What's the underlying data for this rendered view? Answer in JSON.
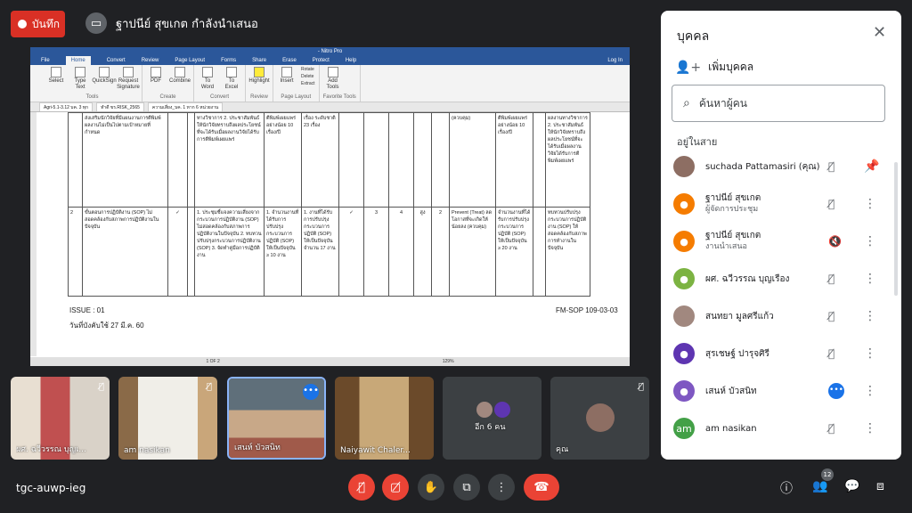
{
  "top": {
    "record_label": "บันทึก",
    "presenter_text": "ฐาปนีย์ สุขเกต กำลังนำเสนอ"
  },
  "screen": {
    "title": "- Nitro Pro",
    "menu": [
      "File",
      "Home",
      "Convert",
      "Review",
      "Page Layout",
      "Forms",
      "Share",
      "Erase",
      "Protect",
      "Help",
      "Log In"
    ],
    "ribbon_groups": [
      {
        "label": "Tools",
        "buttons": [
          "Select",
          "Type Text",
          "QuickSign",
          "Request Signature"
        ]
      },
      {
        "label": "Create",
        "buttons": [
          "PDF",
          "Combine"
        ]
      },
      {
        "label": "Convert",
        "buttons": [
          "To Word",
          "To Excel"
        ]
      },
      {
        "label": "Review",
        "buttons": [
          "Highlight"
        ]
      },
      {
        "label": "Page Layout",
        "buttons": [
          "Insert",
          "Rotate",
          "Delete",
          "Extract"
        ]
      },
      {
        "label": "Favorite Tools",
        "buttons": [
          "Add Tools"
        ]
      }
    ],
    "doc_tabs": [
      "Agri-5.1-3.12 บค. 3 ทุก",
      "ทำดี ขร.RISK_2565",
      "ความเสี่ยง_บค. 1 หาก 6 หน่วยงาน"
    ],
    "table_row1": [
      "",
      "ส่งเสริมนักวิจัยที่มีแผนงานการตีพิมพ์ผลงานไม่เป็นไปตามเป้าหมายที่กำหนด",
      "",
      "",
      "ทางวิชาการ 2. ประชาสัมพันธ์ให้นักวิจัยทราบถึงผลประโยชน์ที่จะได้รับเมื่อผลงานวิจัยได้รับการตีพิมพ์เผยแพร่",
      "ตีพิมพ์เผยแพร่อย่างน้อย 10 เรื่อง/ปี",
      "เรื่อง ระดับชาติ 23 เรื่อง",
      "",
      "",
      "",
      "",
      "",
      "(ควบคุม)",
      "ตีพิมพ์เผยแพร่อย่างน้อย 10 เรื่อง/ปี",
      "",
      "ผลงานทางวิชาการ 2. ประชาสัมพันธ์ให้นักวิจัยทราบถึงผลประโยชน์ที่จะได้รับเมื่อผลงานวิจัยได้รับการตีพิมพ์เผยแพร่"
    ],
    "table_row2": [
      "2",
      "ขั้นตอนการปฏิบัติงาน (SOP) ไม่สอดคล้องกับสภาพการปฏิบัติงานในปัจจุบัน",
      "✓",
      "",
      "1. ประชุมชี้แจงความเสี่ยงจากกระบวนการปฏิบัติงาน (SOP) ไม่สอดคล้องกับสภาพการปฏิบัติงานในปัจจุบัน 2. ทบทวนปรับปรุงกระบวนการปฏิบัติงาน (SOP) 3. จัดทำคู่มือการปฏิบัติงาน",
      "1. จำนวนงานที่ได้รับการปรับปรุงกระบวนการปฏิบัติ (SOP) ให้เป็นปัจจุบัน ≥ 10 งาน",
      "1. งานที่ได้รับการปรับปรุงกระบวนการปฏิบัติ (SOP) ให้เป็นปัจจุบัน จำนวน 17 งาน",
      "✓",
      "3",
      "4",
      "สูง",
      "2",
      "Prevent (Treat) ลดโอกาสที่จะเกิดให้น้อยลง (ควบคุม)",
      "จำนวนงานที่ได้รับการปรับปรุงกระบวนการปฏิบัติ (SOP) ให้เป็นปัจจุบัน ≥ 20 งาน",
      "",
      "ทบทวนปรับปรุงกระบวนการปฏิบัติงาน (SOP) ให้สอดคล้องกับสภาพการทำงานในปัจจุบัน"
    ],
    "issue": "ISSUE :   01",
    "effective": "วันที่บังคับใช้  27  มี.ค. 60",
    "form_code": "FM-SOP 109-03-03",
    "status": "1 OF 2",
    "zoom": "129%"
  },
  "panel": {
    "title": "บุคคล",
    "add_label": "เพิ่มบุคคล",
    "search_placeholder": "ค้นหาผู้คน",
    "section": "อยู่ในสาย",
    "people": [
      {
        "name": "suchada Pattamasiri (คุณ)",
        "sub": "",
        "avatar": "",
        "color": "#8d6e63"
      },
      {
        "name": "ฐาปนีย์ สุขเกต",
        "sub": "ผู้จัดการประชุม",
        "avatar": "",
        "color": "#f57c00"
      },
      {
        "name": "ฐาปนีย์ สุขเกต",
        "sub": "งานนำเสนอ",
        "avatar": "",
        "color": "#f57c00"
      },
      {
        "name": "ผศ. ฉวีวรรณ บุญเรือง",
        "sub": "",
        "avatar": "",
        "color": "#7cb342"
      },
      {
        "name": "สนทยา มูลศรีแก้ว",
        "sub": "",
        "avatar": "",
        "color": "#a1887f"
      },
      {
        "name": "สุรเชษฐ์ ปารุจศิรี",
        "sub": "",
        "avatar": "",
        "color": "#5e35b1"
      },
      {
        "name": "เสนห์ บัวสนิท",
        "sub": "",
        "avatar": "",
        "color": "#7e57c2"
      },
      {
        "name": "am nasikan",
        "sub": "",
        "avatar": "am",
        "color": "#43a047"
      }
    ]
  },
  "tiles": [
    {
      "name": "ผศ. ฉวีวรรณ บุญเ..."
    },
    {
      "name": "am nasikan"
    },
    {
      "name": "เสนห์ บัวสนิท"
    },
    {
      "name": "Naiyawit Chaler..."
    },
    {
      "name": "อีก 6 คน"
    },
    {
      "name": "คุณ"
    }
  ],
  "bottom": {
    "meeting_code": "tgc-auwp-ieg",
    "people_count": "12"
  }
}
